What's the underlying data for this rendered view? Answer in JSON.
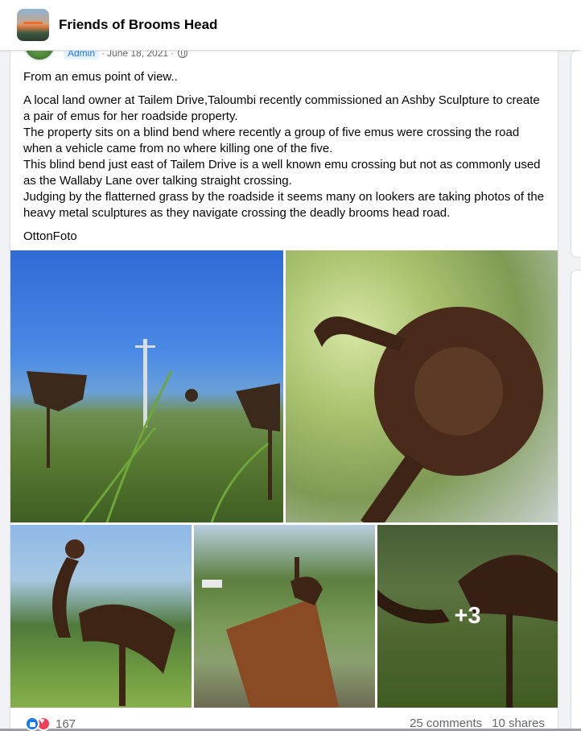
{
  "group": {
    "name": "Friends of Brooms Head",
    "avatar_icon": "group-avatar-icon"
  },
  "post": {
    "author_badge": "Admin",
    "date": "June 18, 2021",
    "separator": "·",
    "privacy_icon": "globe-icon",
    "title_line": "From an emus point of view..",
    "body_lines": [
      "A local land owner at Tailem Drive,Taloumbi recently commissioned an Ashby Sculpture to create a pair of emus for her roadside property.",
      "The property sits on a blind bend where recently a group of five emus were crossing the road when a vehicle came from no where killing one of the five.",
      "This blind bend just east of Tailem Drive is a well known emu crossing  but not as commonly used as the Wallaby Lane over  talking straight crossing.",
      "Judging by the flatterned grass by the roadside it seems many on lookers are taking photos of the heavy metal sculptures as they navigate crossing the deadly brooms head road."
    ],
    "signature": "OttonFoto",
    "more_photos_label": "+3",
    "reaction_count": "167",
    "comments": "25 comments",
    "shares": "10 shares"
  },
  "colors": {
    "brand_blue": "#1877f2",
    "love_red": "#f33e58",
    "secondary_text": "#65676b"
  }
}
